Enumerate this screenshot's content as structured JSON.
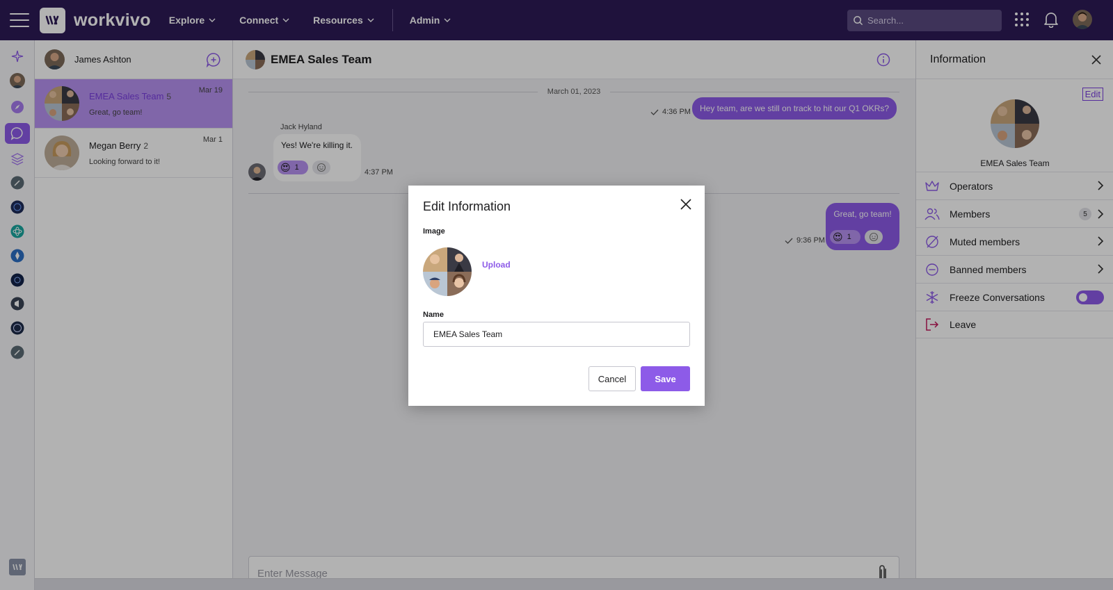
{
  "topbar": {
    "brand": "workvivo",
    "nav": [
      {
        "label": "Explore"
      },
      {
        "label": "Connect"
      },
      {
        "label": "Resources"
      },
      {
        "label": "Admin"
      }
    ],
    "search_placeholder": "Search..."
  },
  "conversations": {
    "current_user": "James Ashton",
    "items": [
      {
        "name": "EMEA Sales Team",
        "count": "5",
        "date": "Mar 19",
        "preview": "Great, go team!"
      },
      {
        "name": "Megan Berry",
        "count": "2",
        "date": "Mar 1",
        "preview": "Looking forward to it!"
      }
    ]
  },
  "chat": {
    "title": "EMEA Sales Team",
    "date_divider": "March 01, 2023",
    "messages": [
      {
        "text": "Hey team, are we still on track to hit our Q1 OKRs?",
        "time": "4:36 PM"
      },
      {
        "sender": "Jack Hyland",
        "text": "Yes! We're killing it.",
        "time": "4:37 PM",
        "reaction_count": "1"
      },
      {
        "text": "Great, go team!",
        "time": "9:36 PM",
        "reaction_count": "1"
      }
    ],
    "composer_placeholder": "Enter Message"
  },
  "info": {
    "title": "Information",
    "edit_label": "Edit",
    "group_name": "EMEA Sales Team",
    "options": [
      {
        "label": "Operators"
      },
      {
        "label": "Members",
        "badge": "5"
      },
      {
        "label": "Muted members"
      },
      {
        "label": "Banned members"
      },
      {
        "label": "Freeze Conversations"
      },
      {
        "label": "Leave"
      }
    ]
  },
  "modal": {
    "title": "Edit Information",
    "image_label": "Image",
    "upload_label": "Upload",
    "name_label": "Name",
    "name_value": "EMEA Sales Team",
    "cancel_label": "Cancel",
    "save_label": "Save"
  },
  "colors": {
    "topbar": "#2d1a57",
    "accent": "#8d5be8",
    "leave": "#c2185b"
  }
}
